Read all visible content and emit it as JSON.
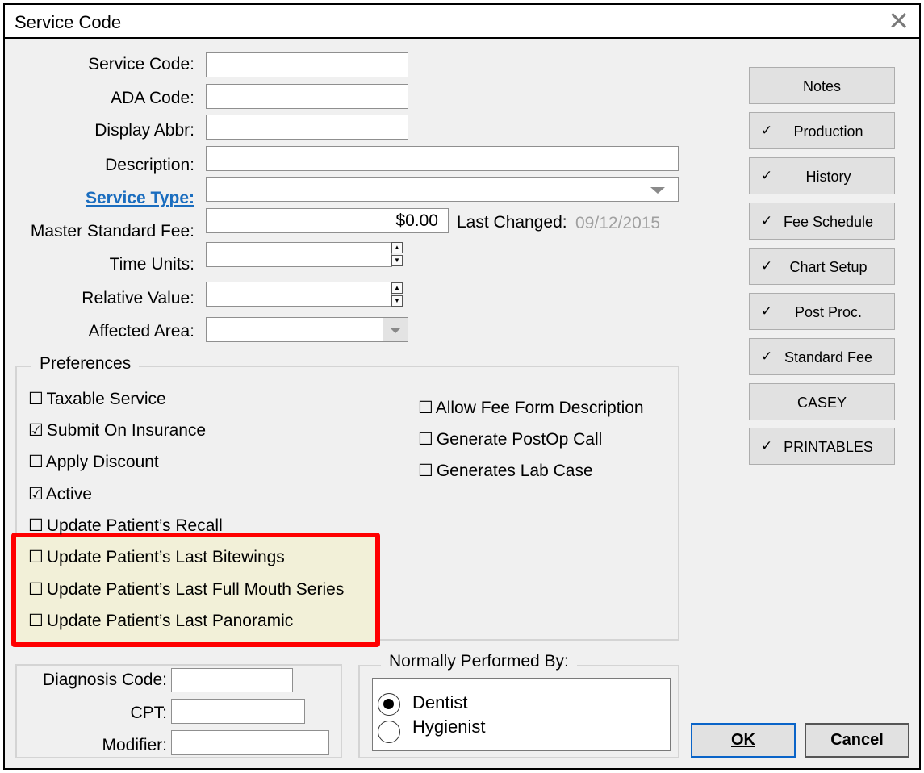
{
  "window": {
    "title": "Service Code",
    "close_glyph": "✕"
  },
  "form": {
    "service_code_label": "Service Code:",
    "ada_code_label": "ADA Code:",
    "display_abbr_label": "Display Abbr:",
    "description_label": "Description:",
    "service_type_label": "Service Type:",
    "master_fee_label": "Master Standard Fee:",
    "master_fee_value": "$0.00",
    "last_changed_label": "Last Changed:",
    "last_changed_value": "09/12/2015",
    "time_units_label": "Time Units:",
    "relative_value_label": "Relative Value:",
    "affected_area_label": "Affected Area:"
  },
  "preferences": {
    "legend": "Preferences",
    "left": [
      {
        "label": "Taxable Service",
        "checked": false
      },
      {
        "label": "Submit On Insurance",
        "checked": true
      },
      {
        "label": "Apply Discount",
        "checked": false
      },
      {
        "label": "Active",
        "checked": true
      },
      {
        "label": "Update Patient’s Recall",
        "checked": false
      },
      {
        "label": "Update Patient’s Last Bitewings",
        "checked": false
      },
      {
        "label": "Update Patient’s Last Full Mouth Series",
        "checked": false
      },
      {
        "label": "Update Patient’s Last Panoramic",
        "checked": false
      }
    ],
    "right": [
      {
        "label": "Allow Fee Form Description",
        "checked": false
      },
      {
        "label": "Generate PostOp Call",
        "checked": false
      },
      {
        "label": "Generates Lab Case",
        "checked": false
      }
    ],
    "unchecked_glyph": "☐",
    "checked_glyph": "☑"
  },
  "codes": {
    "diagnosis_label": "Diagnosis Code:",
    "cpt_label": "CPT:",
    "modifier_label": "Modifier:"
  },
  "performed_by": {
    "legend": "Normally Performed By:",
    "options": [
      {
        "label": "Dentist",
        "selected": true
      },
      {
        "label": "Hygienist",
        "selected": false
      }
    ]
  },
  "side_buttons": [
    {
      "label": "Notes",
      "check": ""
    },
    {
      "label": "Production",
      "check": "✓"
    },
    {
      "label": "History",
      "check": "✓"
    },
    {
      "label": "Fee Schedule",
      "check": "✓"
    },
    {
      "label": "Chart Setup",
      "check": "✓"
    },
    {
      "label": "Post Proc.",
      "check": "✓"
    },
    {
      "label": "Standard Fee",
      "check": "✓"
    },
    {
      "label": "CASEY",
      "check": ""
    },
    {
      "label": "PRINTABLES",
      "check": "✓"
    }
  ],
  "actions": {
    "ok_label": "OK",
    "cancel_label": "Cancel"
  }
}
